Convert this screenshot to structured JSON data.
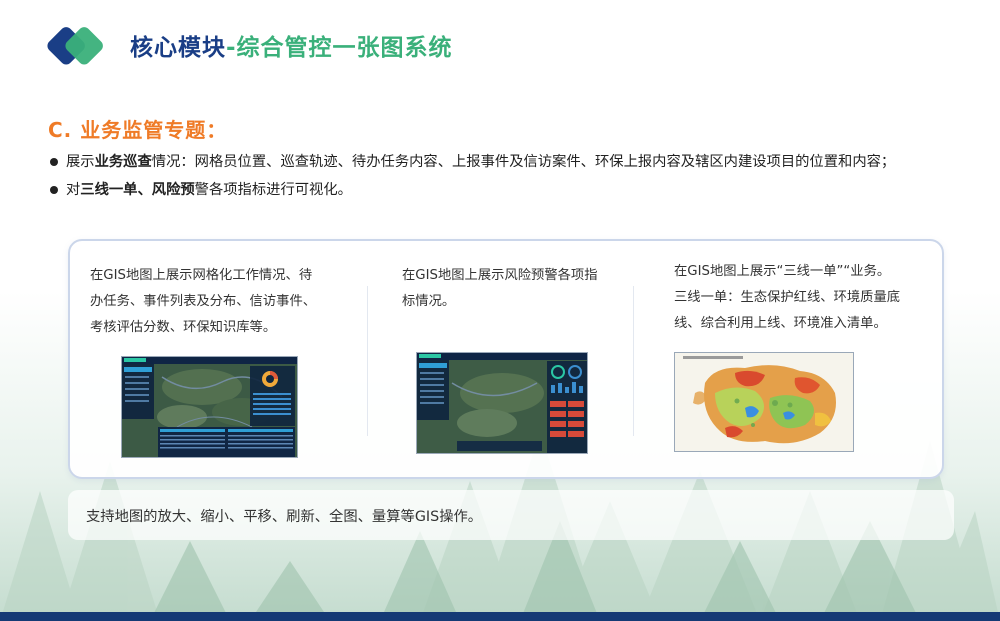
{
  "header": {
    "title_part1": "核心模块",
    "title_part2": "-综合管控一张图系统"
  },
  "section": {
    "heading": "C. 业务监管专题："
  },
  "bullets": [
    {
      "pre": "展示",
      "bold": "业务巡查",
      "post": "情况：网格员位置、巡查轨迹、待办任务内容、上报事件及信访案件、环保上报内容及辖区内建设项目的位置和内容；"
    },
    {
      "pre": "对",
      "bold": "三线一单、风险预",
      "post": "警各项指标进行可视化。"
    }
  ],
  "columns": [
    {
      "lines": [
        "在GIS地图上展示网格化工作情况、待",
        "办任务、事件列表及分布、信访事件、",
        "考核评估分数、环保知识库等。"
      ]
    },
    {
      "lines": [
        "在GIS地图上展示风险预警各项指",
        "标情况。"
      ]
    },
    {
      "lines": [
        "在GIS地图上展示“三线一单”“业务。",
        "三线一单：生态保护红线、环境质量底",
        "线、综合利用上线、环境准入清单。"
      ]
    }
  ],
  "footer": {
    "text": "支持地图的放大、缩小、平移、刷新、全图、量算等GIS操作。"
  },
  "colors": {
    "title_blue": "#1a3e86",
    "title_green": "#3ab07a",
    "accent_orange": "#ef7b27",
    "bottom_bar": "#153a75"
  }
}
